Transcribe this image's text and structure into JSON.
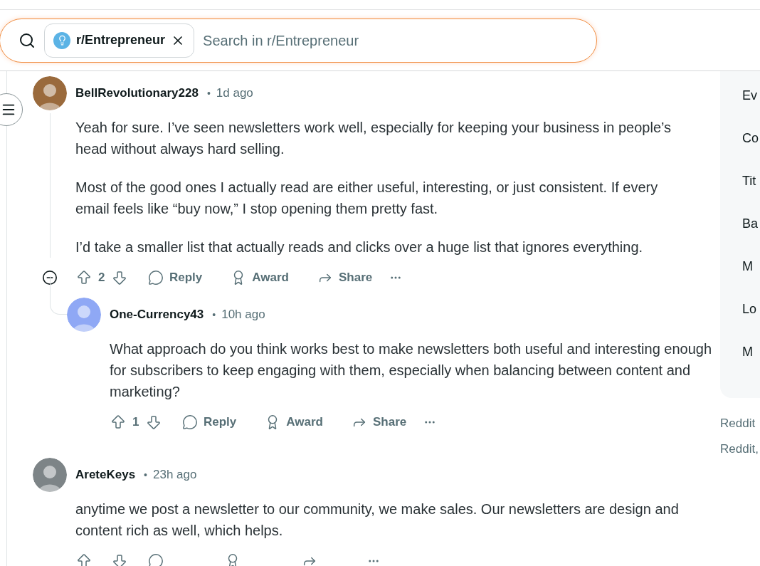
{
  "search": {
    "chip": "r/Entrepreneur",
    "placeholder": "Search in r/Entrepreneur"
  },
  "comments": [
    {
      "author": "BellRevolutionary228",
      "separator": "•",
      "time": "1d ago",
      "avatar": {
        "color": "#9a6a3c"
      },
      "paragraphs": [
        "Yeah for sure. I’ve seen newsletters work well, especially for keeping your business in people’s head without always hard selling.",
        "Most of the good ones I actually read are either useful, interesting, or just consistent. If every email feels like “buy now,” I stop opening them pretty fast.",
        "I’d take a smaller list that actually reads and clicks over a huge list that ignores everything."
      ],
      "votes": "2",
      "actions": [
        "Reply",
        "Award",
        "Share"
      ],
      "replies": [
        {
          "author": "One-Currency43",
          "separator": "•",
          "time": "10h ago",
          "avatar": {
            "color": "#8fa8f5"
          },
          "paragraphs": [
            "What approach do you think works best to make newsletters both useful and interesting enough for subscribers to keep engaging with them, especially when balancing between content and marketing?"
          ],
          "votes": "1",
          "actions": [
            "Reply",
            "Award",
            "Share"
          ]
        }
      ]
    },
    {
      "author": "AreteKeys",
      "separator": "•",
      "time": "23h ago",
      "avatar": {
        "color": "#7d8487"
      },
      "paragraphs": [
        "anytime we post a newsletter to our community, we make sales. Our newsletters are design and content rich as well, which helps."
      ]
    }
  ],
  "sidebar": {
    "items": [
      "Ev",
      "Co",
      "Tit",
      "Ba",
      "M",
      "Lo",
      "M"
    ],
    "footer": [
      "Reddit",
      "Reddit,"
    ]
  }
}
